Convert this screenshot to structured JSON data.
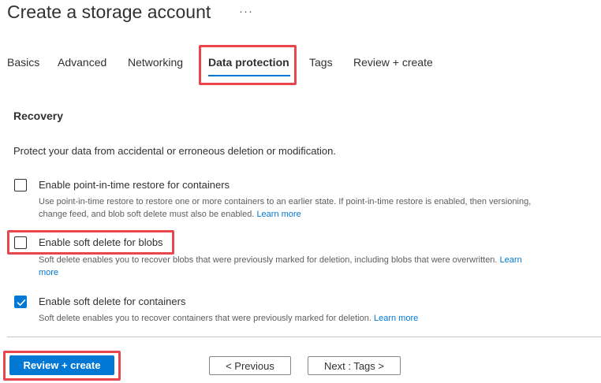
{
  "page": {
    "title": "Create a storage account",
    "more_icon": "ellipsis-icon",
    "more_glyph": "···"
  },
  "tabs": [
    {
      "label": "Basics"
    },
    {
      "label": "Advanced"
    },
    {
      "label": "Networking"
    },
    {
      "label": "Data protection",
      "selected": true
    },
    {
      "label": "Tags"
    },
    {
      "label": "Review + create"
    }
  ],
  "recovery": {
    "heading": "Recovery",
    "description": "Protect your data from accidental or erroneous deletion or modification.",
    "options": [
      {
        "label": "Enable point-in-time restore for containers",
        "checked": false,
        "help_line1": "Use point-in-time restore to restore one or more containers to an earlier state. If point-in-time restore is enabled, then versioning,",
        "help_line2": "change feed, and blob soft delete must also be enabled.",
        "link": "Learn more"
      },
      {
        "label": "Enable soft delete for blobs",
        "checked": false,
        "help_line1": "Soft delete enables you to recover blobs that were previously marked for deletion, including blobs that were overwritten.",
        "link_part1": "Learn",
        "link_part2": "more"
      },
      {
        "label": "Enable soft delete for containers",
        "checked": true,
        "help_line1": "Soft delete enables you to recover containers that were previously marked for deletion.",
        "link": "Learn more"
      }
    ]
  },
  "footer": {
    "review_create": "Review + create",
    "previous": "< Previous",
    "next": "Next : Tags >"
  },
  "colors": {
    "accent": "#0078d4",
    "highlight_box": "#e8464c",
    "text": "#323130",
    "muted": "#605e5c"
  }
}
